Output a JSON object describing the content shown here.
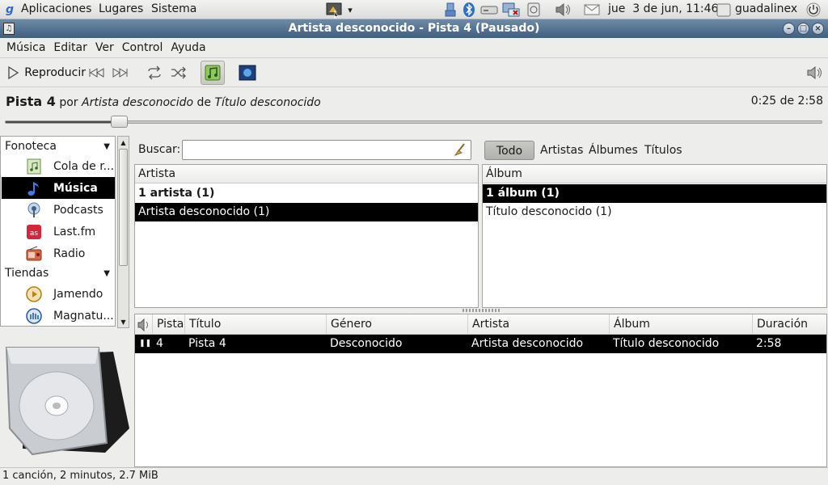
{
  "panel": {
    "menus": [
      "Aplicaciones",
      "Lugares",
      "Sistema"
    ],
    "clock": "jue  3 de jun, 11:46",
    "user": "guadalinex"
  },
  "window": {
    "title": "Artista desconocido - Pista 4 (Pausado)"
  },
  "menubar": [
    "Música",
    "Editar",
    "Ver",
    "Control",
    "Ayuda"
  ],
  "toolbar": {
    "play_label": "Reproducir"
  },
  "now_playing": {
    "track": "Pista 4",
    "by": "por",
    "artist": "Artista desconocido",
    "of": "de",
    "album": "Título desconocido",
    "time": "0:25 de 2:58",
    "progress": 0.14
  },
  "sidebar": {
    "library_header": "Fonoteca",
    "stores_header": "Tiendas",
    "items": [
      {
        "label": "Cola de r...",
        "icon": "queue-icon"
      },
      {
        "label": "Música",
        "icon": "music-note-icon",
        "selected": true
      },
      {
        "label": "Podcasts",
        "icon": "podcast-icon"
      },
      {
        "label": "Last.fm",
        "icon": "lastfm-icon"
      },
      {
        "label": "Radio",
        "icon": "radio-icon"
      }
    ],
    "stores": [
      {
        "label": "Jamendo",
        "icon": "jamendo-icon"
      },
      {
        "label": "Magnatu...",
        "icon": "magnatune-icon"
      }
    ]
  },
  "search": {
    "label": "Buscar:",
    "value": ""
  },
  "filters": [
    "Todo",
    "Artistas",
    "Álbumes",
    "Títulos"
  ],
  "artist_pane": {
    "header": "Artista",
    "rows": [
      "1 artista (1)",
      "Artista desconocido (1)"
    ]
  },
  "album_pane": {
    "header": "Álbum",
    "rows": [
      "1 álbum (1)",
      "Título desconocido (1)"
    ]
  },
  "tracklist": {
    "columns": [
      "Pista",
      "Título",
      "Género",
      "Artista",
      "Álbum",
      "Duración"
    ],
    "rows": [
      {
        "track": "4",
        "title": "Pista 4",
        "genre": "Desconocido",
        "artist": "Artista desconocido",
        "album": "Título desconocido",
        "duration": "2:58"
      }
    ]
  },
  "status": "1 canción, 2 minutos, 2.7 MiB",
  "colors": {
    "titlebar": "#4a6b8c",
    "selection": "#000000"
  }
}
